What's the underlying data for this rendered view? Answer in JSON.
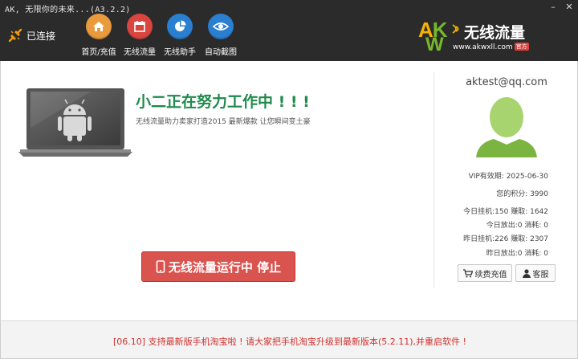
{
  "window": {
    "title": "AK, 无限你的未来...(A3.2.2)",
    "minimize": "–",
    "close": "✕"
  },
  "connection": {
    "status": "已连接"
  },
  "nav": [
    {
      "label": "首页/充值",
      "icon": "home-icon",
      "color": "#e89a3c"
    },
    {
      "label": "无线流量",
      "icon": "calendar-icon",
      "color": "#d9463f"
    },
    {
      "label": "无线助手",
      "icon": "pie-chart-icon",
      "color": "#2a7fd1"
    },
    {
      "label": "自动截图",
      "icon": "eye-icon",
      "color": "#2a7fd1"
    }
  ],
  "logo": {
    "ak_a": "A",
    "ak_k": "K",
    "ak_w": "W",
    "name": "无线流量",
    "url": "www.akwxll.com",
    "badge": "官方"
  },
  "main": {
    "headline": "小二正在努力工作中 ! ! !",
    "subline": "无线流量助力卖家打造2015 最新爆款 让您瞬间变土豪",
    "run_button": "无线流量运行中 停止"
  },
  "account": {
    "email": "aktest@qq.com",
    "vip_expiry": "VIP有效期: 2025-06-30",
    "points": "您的积分: 3990",
    "today_hang": "今日挂机:150 赚取: 1642",
    "today_release": "今日放出:0 消耗: 0",
    "yesterday_hang": "昨日挂机:226 赚取: 2307",
    "yesterday_release": "昨日放出:0 消耗: 0",
    "renew_button": "续费充值",
    "support_button": "客服"
  },
  "footer": {
    "notice": "[06.10] 支持最新版手机淘宝啦 ! 请大家把手机淘宝升级到最新版本(5.2.11),并重启软件 !"
  }
}
